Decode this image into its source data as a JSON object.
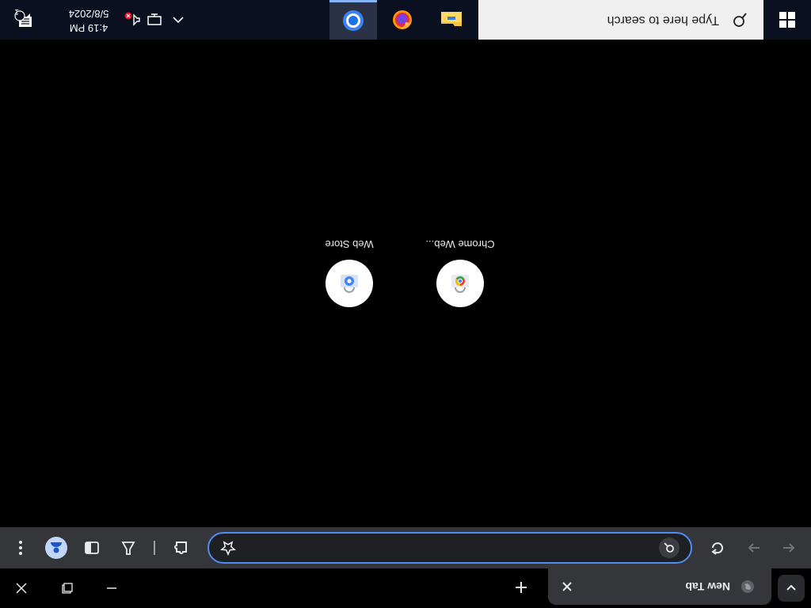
{
  "browser": {
    "tab": {
      "title": "New Tab"
    },
    "omnibox": {
      "value": ""
    }
  },
  "shortcuts": [
    {
      "label": "Chrome Web...",
      "icon": "chrome-web-store-icon"
    },
    {
      "label": "Web Store",
      "icon": "web-store-icon"
    }
  ],
  "taskbar": {
    "search_placeholder": "Type here to search",
    "apps": [
      "file-explorer-icon",
      "firefox-icon",
      "chrome-icon"
    ],
    "clock": {
      "time": "4:19 PM",
      "date": "5/8/2024"
    },
    "notification_count": "1"
  },
  "colors": {
    "accent": "#4c8df6",
    "toolbar": "#35363a",
    "taskbar": "#0b1020"
  }
}
